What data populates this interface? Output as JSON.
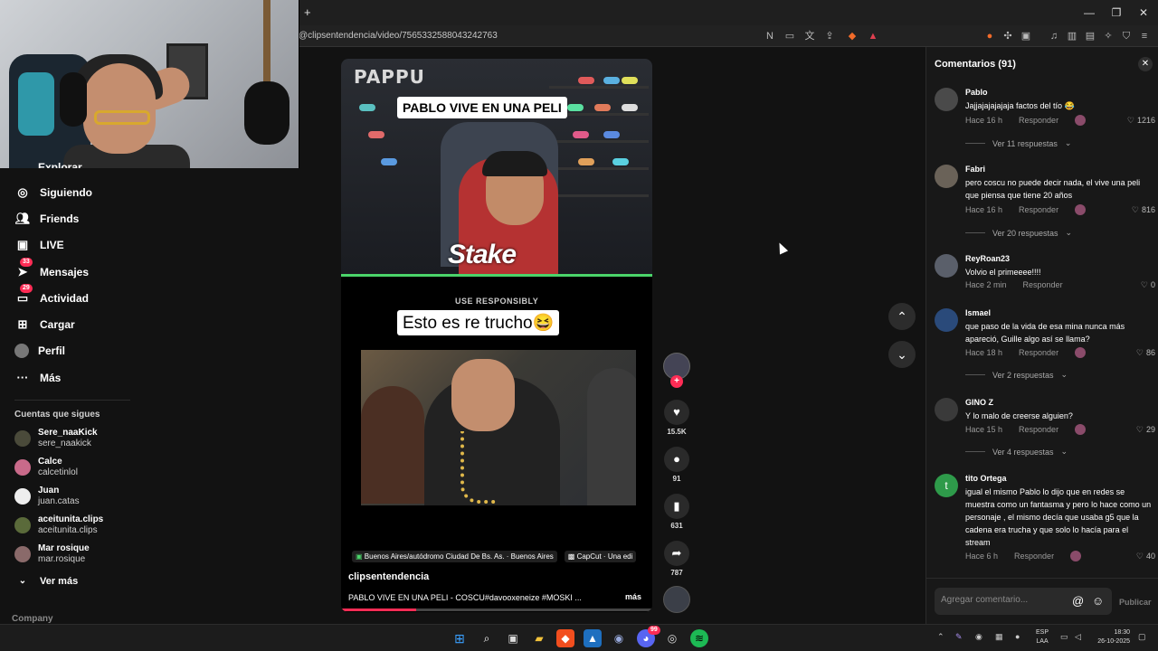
{
  "browser": {
    "new_tab": "+",
    "url": "@clipsentendencia/video/7565332588043242763",
    "window_controls": [
      "—",
      "❐",
      "✕"
    ]
  },
  "sidebar": {
    "partial_item": "Explorar",
    "items": [
      {
        "label": "Siguiendo",
        "icon": "following-icon"
      },
      {
        "label": "Friends",
        "icon": "friends-icon"
      },
      {
        "label": "LIVE",
        "icon": "live-icon"
      },
      {
        "label": "Mensajes",
        "icon": "messages-icon",
        "badge": "33"
      },
      {
        "label": "Actividad",
        "icon": "activity-icon",
        "badge": "29"
      },
      {
        "label": "Cargar",
        "icon": "upload-icon"
      },
      {
        "label": "Perfil",
        "icon": "profile-icon"
      },
      {
        "label": "Más",
        "icon": "more-icon"
      }
    ],
    "following_title": "Cuentas que sigues",
    "accounts": [
      {
        "name": "Sere_naaKick",
        "handle": "sere_naakick"
      },
      {
        "name": "Calce",
        "handle": "calcetinlol"
      },
      {
        "name": "Juan",
        "handle": "juan.catas"
      },
      {
        "name": "aceitunita.clips",
        "handle": "aceitunita.clips"
      },
      {
        "name": "Mar rosique",
        "handle": "mar.rosique"
      }
    ],
    "see_more": "Ver más",
    "company": "Company"
  },
  "video": {
    "watermark": "PAPPU",
    "caption_top": "PABLO VIVE EN UNA PELI",
    "sponsor": "Stake",
    "sponsor_sub": "USE RESPONSIBLY",
    "caption_mid": "Esto es re trucho😆",
    "location": "Buenos Aires/autódromo Ciudad De Bs. As. · Buenos Aires",
    "capcut": "CapCut · Una edi",
    "author": "clipsentendencia",
    "description": "PABLO VIVE EN UNA PELI - COSCU#davooxeneize #MOSKI ...",
    "more": "más",
    "progress": 0.24
  },
  "actions": {
    "likes": "15.5K",
    "comments": "91",
    "saves": "631",
    "shares": "787"
  },
  "comments_panel": {
    "title": "Comentarios (91)",
    "input_placeholder": "Agregar comentario...",
    "post": "Publicar",
    "reply_label": "Responder",
    "items": [
      {
        "name": "Pablo",
        "text": "Jajjajajajajaja factos del tío 😂",
        "time": "Hace 16 h",
        "likes": "1216",
        "replies": "Ver 11 respuestas"
      },
      {
        "name": "Fabri",
        "text": "pero coscu no puede decir nada, el vive una peli que piensa que tiene 20 años",
        "time": "Hace 16 h",
        "likes": "816",
        "replies": "Ver 20 respuestas"
      },
      {
        "name": "ReyRoan23",
        "text": "Volvio el primeeee!!!!",
        "time": "Hace 2 min",
        "likes": "0",
        "replies": ""
      },
      {
        "name": "Ismael",
        "text": "que paso de la vida de esa mina nunca más apareció, Guille algo así se llama?",
        "time": "Hace 18 h",
        "likes": "86",
        "replies": "Ver 2 respuestas"
      },
      {
        "name": "GINO Z",
        "text": "Y lo malo de creerse alguien?",
        "time": "Hace 15 h",
        "likes": "29",
        "replies": "Ver 4 respuestas"
      },
      {
        "name": "tito Ortega",
        "text": "igual el mismo Pablo lo dijo que en redes se muestra como un fantasma y pero lo hace como un personaje , el mismo decía que usaba g5 que la cadena era trucha y que solo lo hacía para el stream",
        "time": "Hace 6 h",
        "likes": "40",
        "replies": "",
        "avatar_letter": "t"
      }
    ]
  },
  "taskbar": {
    "lang": "ESP",
    "lang2": "LAA",
    "time": "18:30",
    "date": "26-10-2025",
    "discord_badge": "99"
  }
}
